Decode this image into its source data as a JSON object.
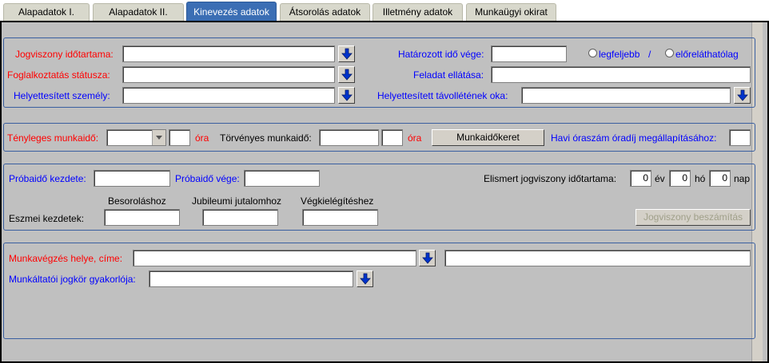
{
  "tabs": [
    {
      "label": "Alapadatok I."
    },
    {
      "label": "Alapadatok II."
    },
    {
      "label": "Kinevezés adatok"
    },
    {
      "label": "Átsorolás adatok"
    },
    {
      "label": "Illetmény adatok"
    },
    {
      "label": "Munkaügyi okirat"
    }
  ],
  "active_tab": "Kinevezés adatok",
  "section1": {
    "jogviszony_idotartama": "Jogviszony időtartama:",
    "foglalkoztatas_statusza": "Foglalkoztatás státusza:",
    "helyettesitett_szemely": "Helyettesített személy:",
    "hatarozott_ido_vege": "Határozott idő vége:",
    "legfeljebb": "legfeljebb",
    "slash": "/",
    "elorelathatolag": "előreláthatólag",
    "feladat_ellatasa": "Feladat ellátása:",
    "helyettesitett_tavolletenek_oka": "Helyettesített távollétének oka:"
  },
  "section2": {
    "tenyleges_munkaido": "Tényleges munkaidő:",
    "ora1": "óra",
    "torvenyes_munkaido": "Törvényes munkaidő:",
    "ora2": "óra",
    "munkaidokeret_button": "Munkaidőkeret",
    "havi_oraszam": "Havi óraszám óradíj megállapításához:"
  },
  "section3": {
    "probaido_kezdete": "Próbaidő kezdete:",
    "probaido_vege": "Próbaidő vége:",
    "elismert_jogviszony": "Elismert jogviszony időtartama:",
    "ev_value": "0",
    "ev": "év",
    "ho_value": "0",
    "ho": "hó",
    "nap_value": "0",
    "nap": "nap",
    "besorolashoz": "Besoroláshoz",
    "jubileumi": "Jubileumi jutalomhoz",
    "vegkielegiteshez": "Végkielégítéshez",
    "eszmei_kezdetek": "Eszmei kezdetek:",
    "jogviszony_beszamitas": "Jogviszony beszámítás"
  },
  "section4": {
    "munkavegzes_helye": "Munkavégzés helye, címe:",
    "munkaltatoi_jogkor": "Munkáltatói jogkör gyakorlója:"
  },
  "colors": {
    "active_tab": "#3b6eb4",
    "panel": "#c0c0c0",
    "required_label": "#ff0000",
    "optional_label": "#0000ff",
    "group_border": "#3a5fa0",
    "drop_arrow": "#0033cc"
  }
}
